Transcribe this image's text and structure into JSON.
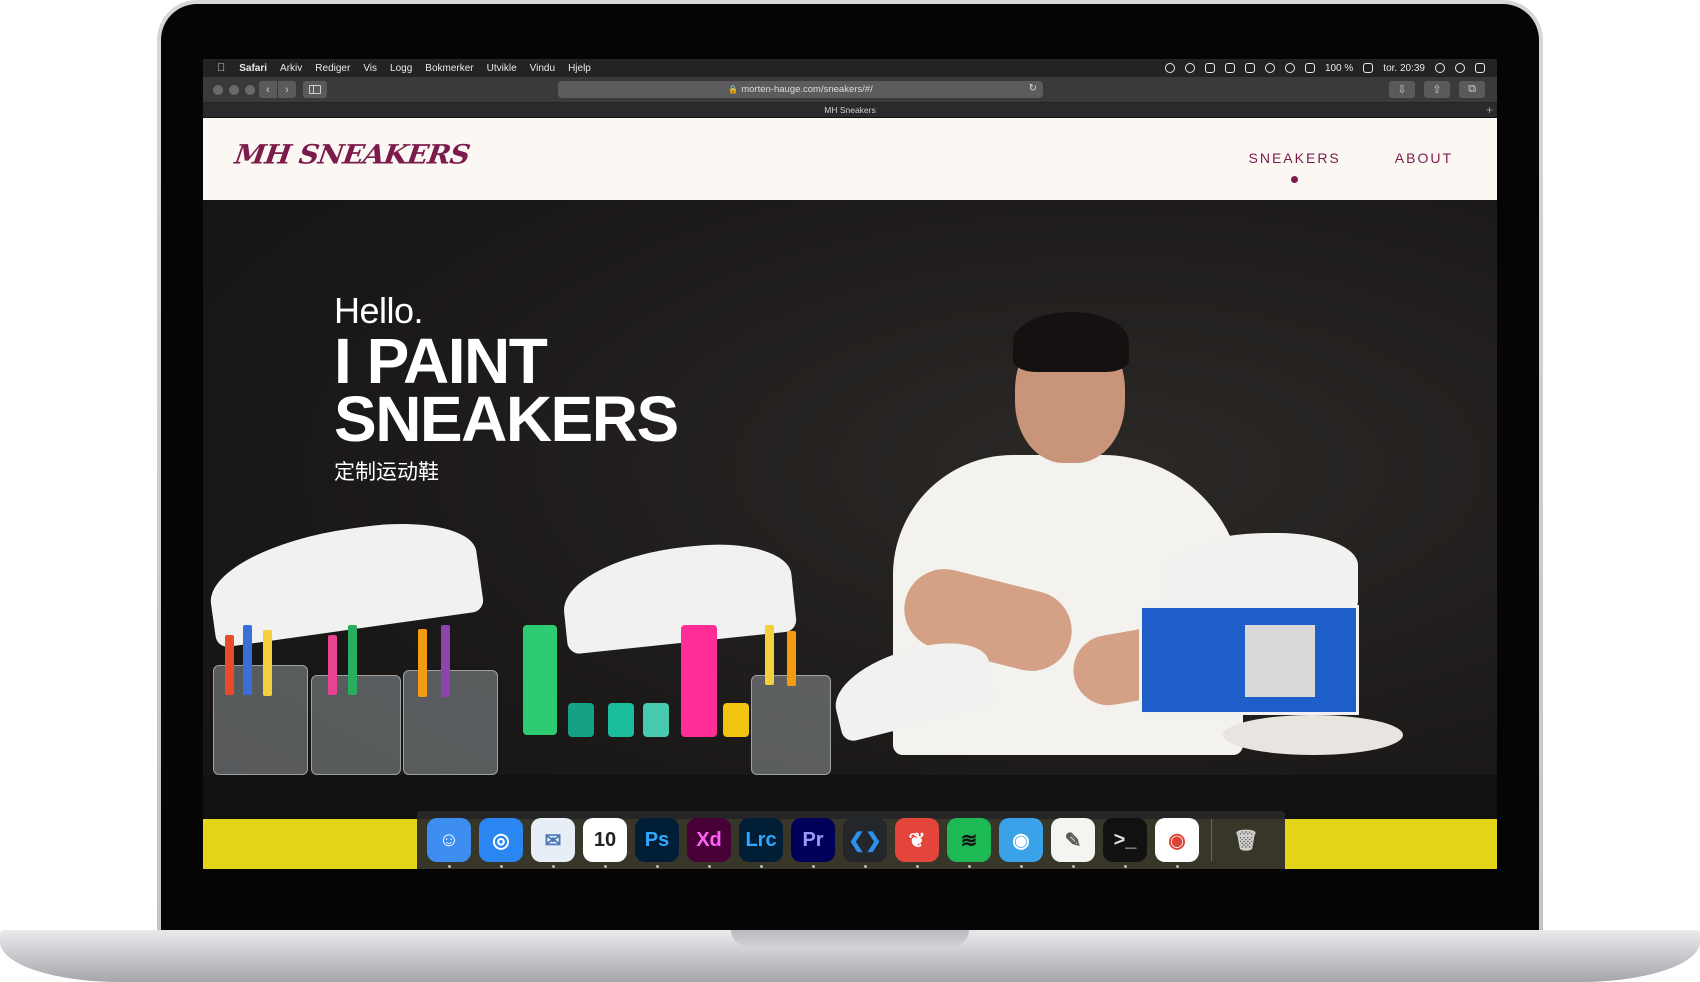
{
  "mac_menubar": {
    "apple_icon": "apple-icon",
    "items": [
      "Safari",
      "Arkiv",
      "Rediger",
      "Vis",
      "Logg",
      "Bokmerker",
      "Utvikle",
      "Vindu",
      "Hjelp"
    ],
    "battery": "100 %",
    "clock": "tor. 20:39"
  },
  "browser": {
    "url": "morten-hauge.com/sneakers/#/",
    "tab_title": "MH Sneakers"
  },
  "site": {
    "logo": "MH SNEAKERS",
    "nav": [
      "SNEAKERS",
      "ABOUT"
    ],
    "active_nav": "SNEAKERS",
    "brand_color": "#7b1b4c",
    "hero": {
      "hello": "Hello.",
      "line1": "I PAINT",
      "line2": "SNEAKERS",
      "chinese": "定制运动鞋"
    }
  },
  "dock": {
    "apps": [
      {
        "name": "Finder",
        "icon": "finder-icon",
        "label": "☺",
        "bg": "#3d8ef0",
        "fg": "#ffffff"
      },
      {
        "name": "Safari",
        "icon": "safari-icon",
        "label": "◎",
        "bg": "#2a86f0",
        "fg": "#ffffff"
      },
      {
        "name": "Mail",
        "icon": "mail-icon",
        "label": "✉",
        "bg": "#e8eef5",
        "fg": "#4a78b8"
      },
      {
        "name": "Calendar",
        "icon": "calendar-icon",
        "label": "10",
        "bg": "#ffffff",
        "fg": "#222222"
      },
      {
        "name": "Photoshop",
        "icon": "photoshop-icon",
        "label": "Ps",
        "bg": "#001e36",
        "fg": "#31a8ff"
      },
      {
        "name": "Adobe XD",
        "icon": "xd-icon",
        "label": "Xd",
        "bg": "#470137",
        "fg": "#ff61f6"
      },
      {
        "name": "Lightroom Classic",
        "icon": "lightroom-icon",
        "label": "Lrc",
        "bg": "#001e36",
        "fg": "#31a8ff"
      },
      {
        "name": "Premiere Pro",
        "icon": "premiere-icon",
        "label": "Pr",
        "bg": "#00005b",
        "fg": "#9999ff"
      },
      {
        "name": "VS Code",
        "icon": "vscode-icon",
        "label": "❮❯",
        "bg": "#23262b",
        "fg": "#2d8ff0"
      },
      {
        "name": "Mail app",
        "icon": "leaf-app-icon",
        "label": "❦",
        "bg": "#e4453a",
        "fg": "#ffffff"
      },
      {
        "name": "Spotify",
        "icon": "spotify-icon",
        "label": "≋",
        "bg": "#1db954",
        "fg": "#111111"
      },
      {
        "name": "Tweetbot",
        "icon": "tweetbot-icon",
        "label": "◉",
        "bg": "#3aa2e8",
        "fg": "#ffffff"
      },
      {
        "name": "TextEdit",
        "icon": "textedit-icon",
        "label": "✎",
        "bg": "#f4f4f0",
        "fg": "#555555"
      },
      {
        "name": "Terminal",
        "icon": "terminal-icon",
        "label": ">_",
        "bg": "#111111",
        "fg": "#dddddd"
      },
      {
        "name": "Chrome",
        "icon": "chrome-icon",
        "label": "◉",
        "bg": "#ffffff",
        "fg": "#db4437"
      }
    ],
    "trash": {
      "name": "Trash",
      "icon": "trash-icon",
      "label": "🗑"
    }
  }
}
